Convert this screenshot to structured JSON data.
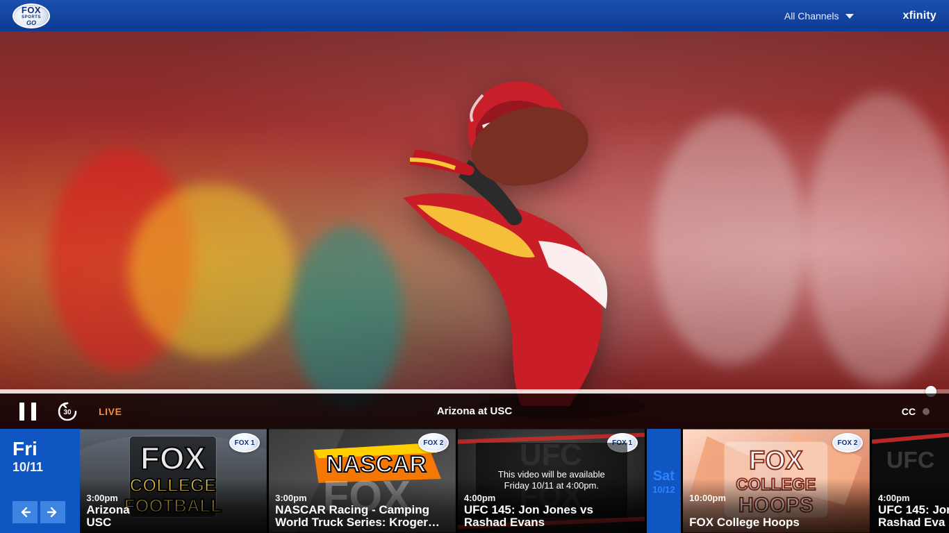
{
  "header": {
    "logo": {
      "line1": "FOX",
      "line2": "SPORTS",
      "line3": "GO"
    },
    "channels_label": "All Channels",
    "brand": "xfinity"
  },
  "player": {
    "status": "LIVE",
    "now_playing": "Arizona at USC",
    "cc_label": "CC",
    "progress_fraction": 0.981
  },
  "schedule": {
    "day1": {
      "day": "Fri",
      "date": "10/11"
    },
    "day2": {
      "day": "Sat",
      "date": "10/12"
    },
    "tiles": [
      {
        "badge": "FOX 1",
        "time": "3:00pm",
        "title_line1": "Arizona",
        "title_line2": "USC",
        "art": "FOX COLLEGE FOOTBALL"
      },
      {
        "badge": "FOX 2",
        "time": "3:00pm",
        "title_line1": "NASCAR Racing - Camping",
        "title_line2": "World Truck Series: Kroger…",
        "art": "NASCAR FOX"
      },
      {
        "badge": "FOX 1",
        "time": "4:00pm",
        "title_line1": "UFC 145: Jon Jones vs",
        "title_line2": "Rashad Evans",
        "art": "UFC",
        "availability_message_line1": "This video will be available",
        "availability_message_line2": "Friday 10/11 at 4:00pm."
      },
      {
        "badge": "FOX 2",
        "time": "10:00pm",
        "title_line1": "FOX College Hoops",
        "title_line2": "",
        "art": "FOX COLLEGE HOOPS"
      },
      {
        "badge": "",
        "time": "4:00pm",
        "title_line1": "UFC 145: Jor",
        "title_line2": "Rashad Eva",
        "art": "UFC"
      }
    ]
  },
  "icons": {
    "pause": "pause-icon",
    "rewind_30": "rewind-30-icon",
    "arrow_left": "arrow-left-icon",
    "arrow_right": "arrow-right-icon",
    "dropdown": "chevron-down-icon"
  },
  "colors": {
    "header_blue": "#0d3b93",
    "day_blue": "#0f56c3",
    "live_orange": "#ff8a2a"
  }
}
